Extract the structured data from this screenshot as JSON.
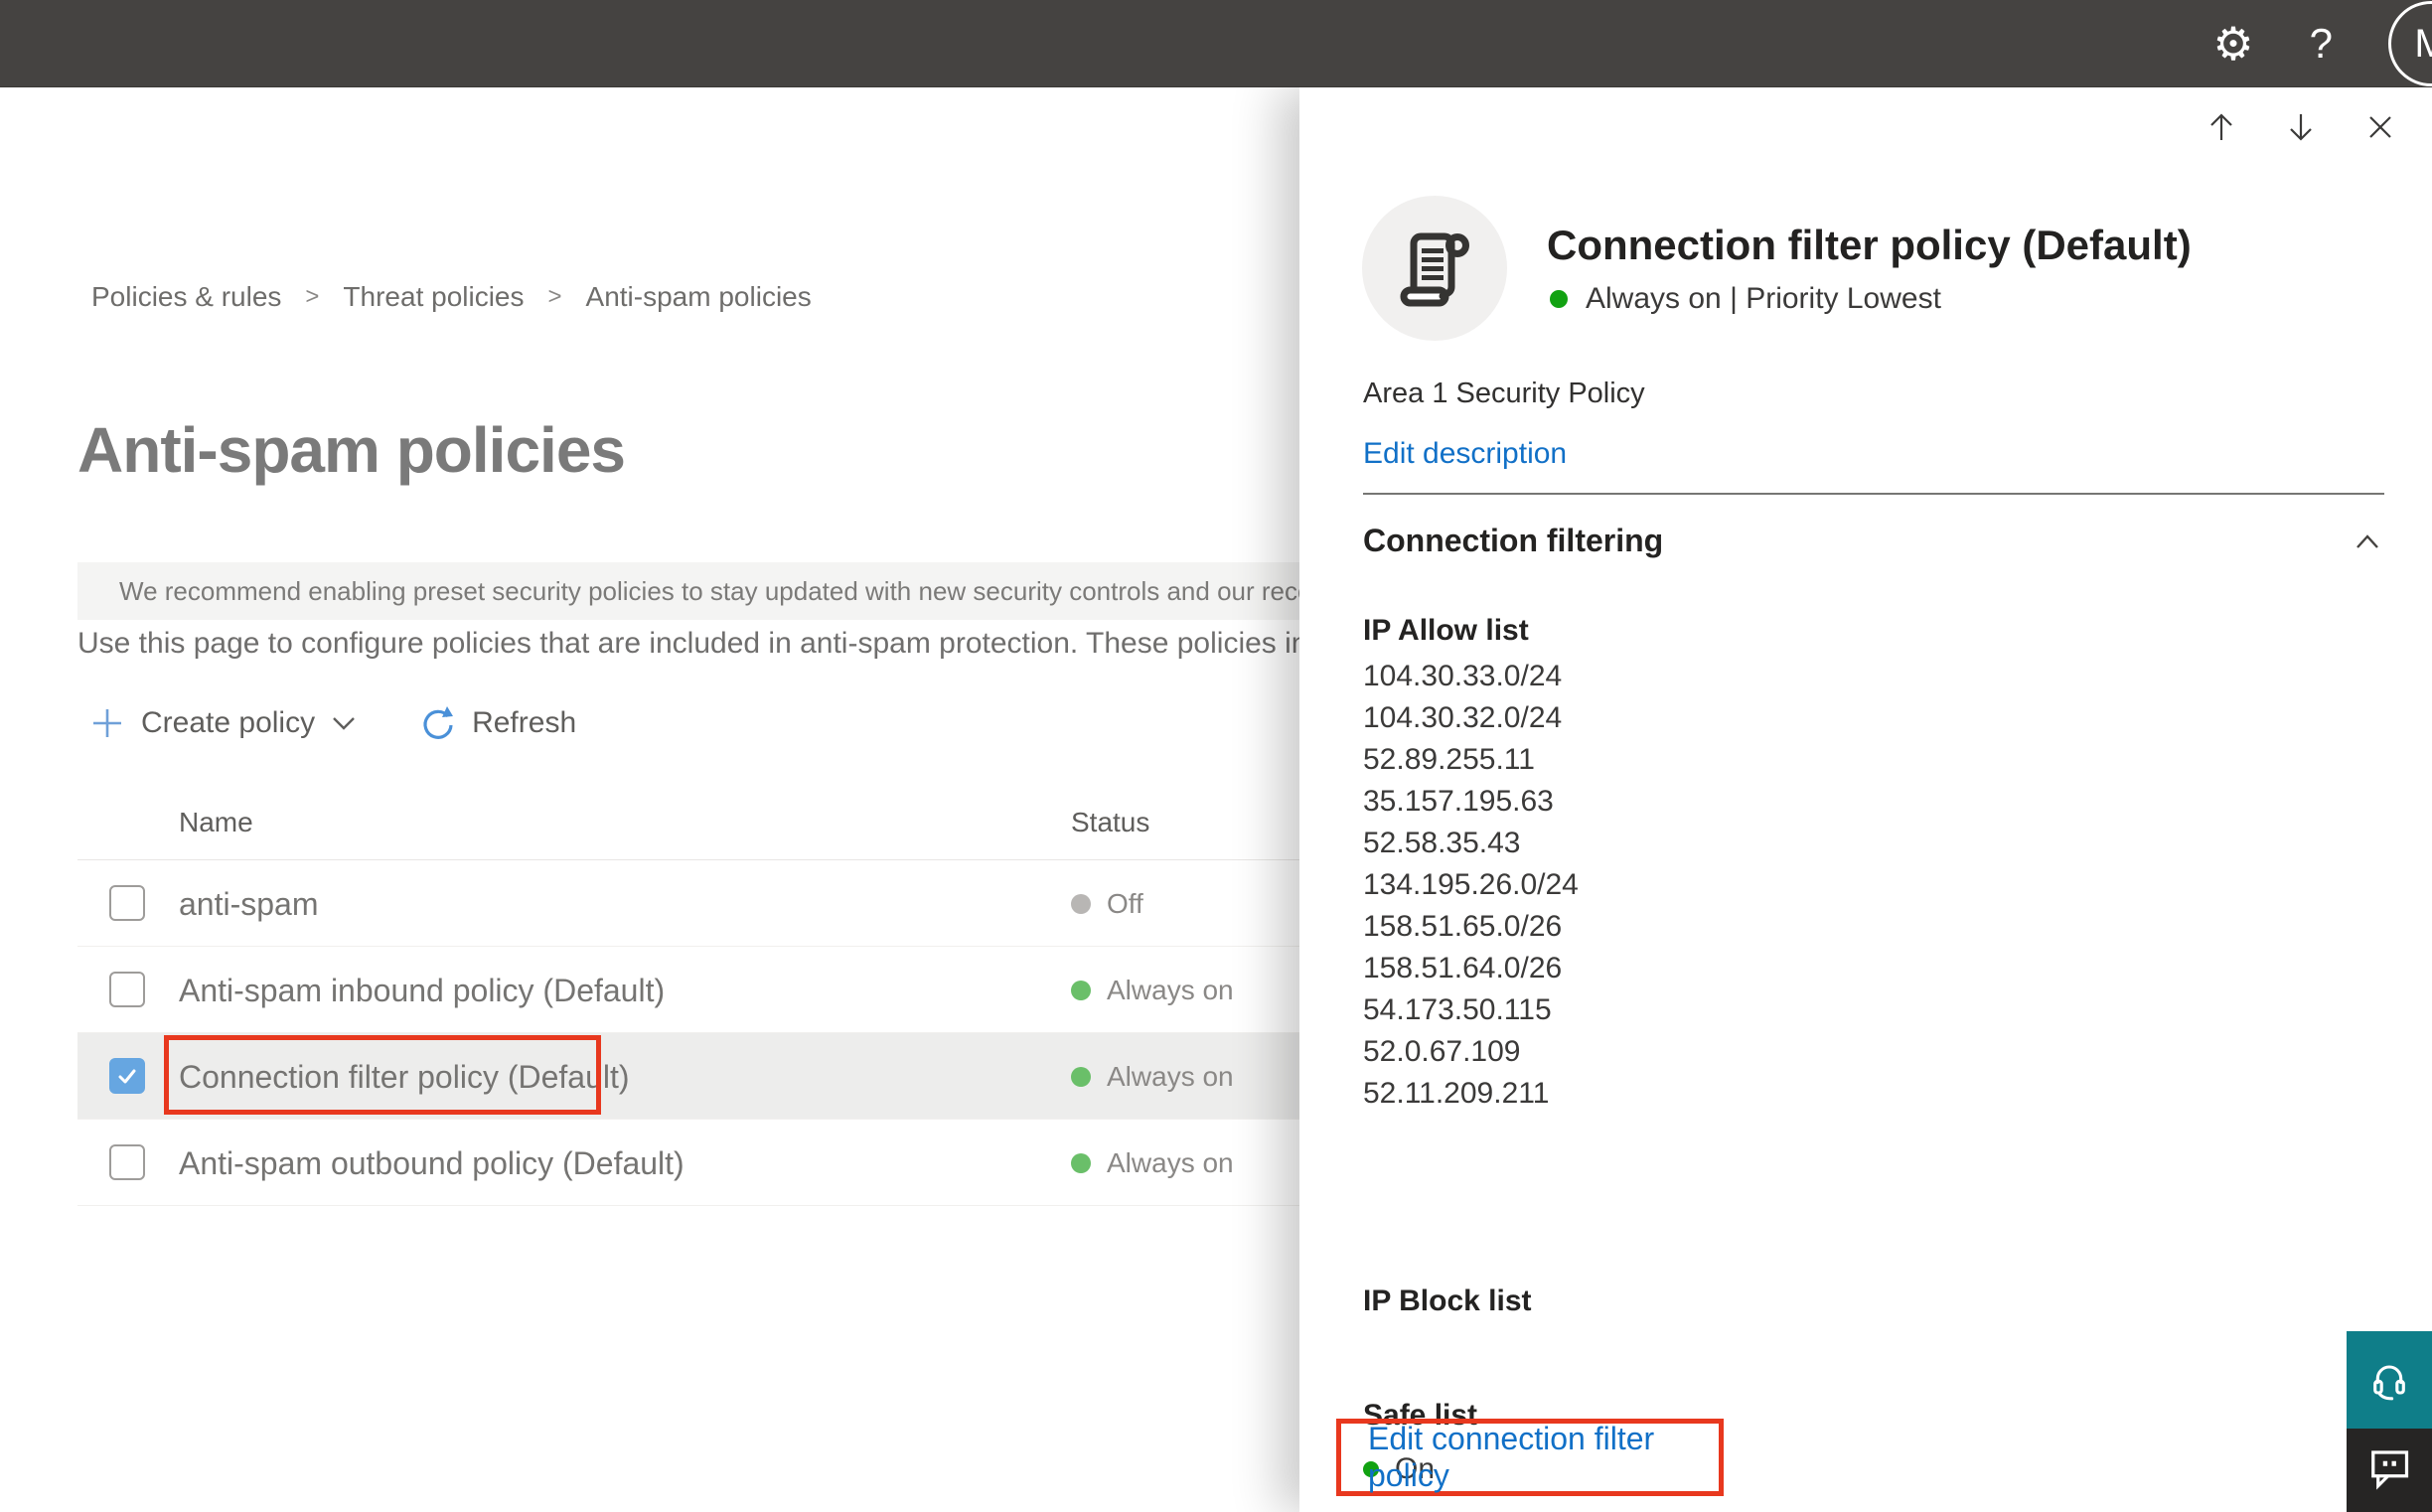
{
  "topbar": {
    "avatar_initial": "M",
    "gear_glyph": "⚙",
    "help_glyph": "?"
  },
  "breadcrumb": {
    "separator": ">",
    "items": [
      "Policies & rules",
      "Threat policies",
      "Anti-spam policies"
    ]
  },
  "page": {
    "title": "Anti-spam policies",
    "banner_text": "We recommend enabling preset security policies to stay updated with new security controls and our recomme",
    "description": "Use this page to configure policies that are included in anti-spam protection. These policies include"
  },
  "toolbar": {
    "create_policy_label": "Create policy",
    "refresh_label": "Refresh"
  },
  "policy_table": {
    "columns": [
      "Name",
      "Status"
    ],
    "rows": [
      {
        "name": "anti-spam",
        "status": "Off",
        "status_color": "gray",
        "checked": false,
        "highlighted": false,
        "annotated": false
      },
      {
        "name": "Anti-spam inbound policy (Default)",
        "status": "Always on",
        "status_color": "green",
        "checked": false,
        "highlighted": false,
        "annotated": false
      },
      {
        "name": "Connection filter policy (Default)",
        "status": "Always on",
        "status_color": "green",
        "checked": true,
        "highlighted": true,
        "annotated": true
      },
      {
        "name": "Anti-spam outbound policy (Default)",
        "status": "Always on",
        "status_color": "green",
        "checked": false,
        "highlighted": false,
        "annotated": false
      }
    ]
  },
  "flyout": {
    "title": "Connection filter policy (Default)",
    "status_line": "Always on | Priority Lowest",
    "description": "Area 1 Security Policy",
    "edit_description_label": "Edit description",
    "section_title": "Connection filtering",
    "ip_allow_title": "IP Allow list",
    "ip_allow_list": [
      "104.30.33.0/24",
      "104.30.32.0/24",
      "52.89.255.11",
      "35.157.195.63",
      "52.58.35.43",
      "134.195.26.0/24",
      "158.51.65.0/26",
      "158.51.64.0/26",
      "54.173.50.115",
      "52.0.67.109",
      "52.11.209.211"
    ],
    "ip_block_title": "IP Block list",
    "safe_list_title": "Safe list",
    "safe_list_status": "On",
    "edit_link_label": "Edit connection filter policy"
  },
  "colors": {
    "topbar_bg": "#454341",
    "link_blue": "#1170c7",
    "toolbar_icon_blue": "#5b9bd5",
    "checkbox_checked_blue": "#66a6e1",
    "status_green_soft": "#6abf69",
    "status_green_bright": "#12a212",
    "status_gray": "#b8b6b4",
    "annotation_red": "#e8381e",
    "support_teal": "#0f7e89",
    "feedback_dark": "#262524"
  }
}
